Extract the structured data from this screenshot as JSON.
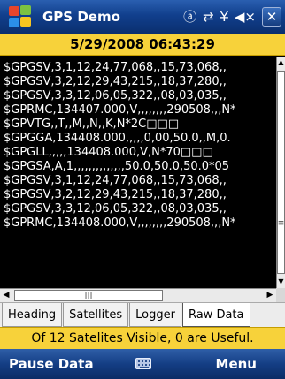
{
  "titlebar": {
    "title": "GPS Demo",
    "tray_icons": [
      "input-method-icon",
      "connectivity-icon",
      "signal-icon",
      "volume-icon"
    ],
    "tray_glyphs": {
      "input": "ⓐ",
      "connectivity": "⇄",
      "signal": "Y̶",
      "volume": "◀×"
    },
    "close_label": "✕"
  },
  "datetime": "5/29/2008 06:43:29",
  "nmea_lines": [
    "$GPGSV,3,1,12,24,77,068,,15,73,068,,",
    "$GPGSV,3,2,12,29,43,215,,18,37,280,,",
    "$GPGSV,3,3,12,06,05,322,,08,03,035,,",
    "$GPRMC,134407.000,V,,,,,,,,290508,,,N*",
    "$GPVTG,,T,,M,,N,,K,N*2C□□□",
    "$GPGGA,134408.000,,,,,0,00,50.0,,M,0.",
    "$GPGLL,,,,,134408.000,V,N*70□□□",
    "$GPGSA,A,1,,,,,,,,,,,,,,50.0,50.0,50.0*05",
    "$GPGSV,3,1,12,24,77,068,,15,73,068,,",
    "$GPGSV,3,2,12,29,43,215,,18,37,280,,",
    "$GPGSV,3,3,12,06,05,322,,08,03,035,,",
    "$GPRMC,134408.000,V,,,,,,,,290508,,,N*"
  ],
  "scroll": {
    "up_arrow": "▲",
    "down_arrow": "▼",
    "left_arrow": "◀",
    "right_arrow": "▶",
    "v_grip": "≡",
    "h_grip": "|||"
  },
  "tabs": [
    {
      "label": "Heading",
      "active": false
    },
    {
      "label": "Satellites",
      "active": false
    },
    {
      "label": "Logger",
      "active": false
    },
    {
      "label": "Raw Data",
      "active": true
    }
  ],
  "status": "Of 12 Satelites Visible, 0 are Useful.",
  "softkeys": {
    "left": "Pause Data",
    "right": "Menu"
  },
  "colors": {
    "accent_yellow": "#f7d23a",
    "titlebar_blue": "#113f8d"
  }
}
